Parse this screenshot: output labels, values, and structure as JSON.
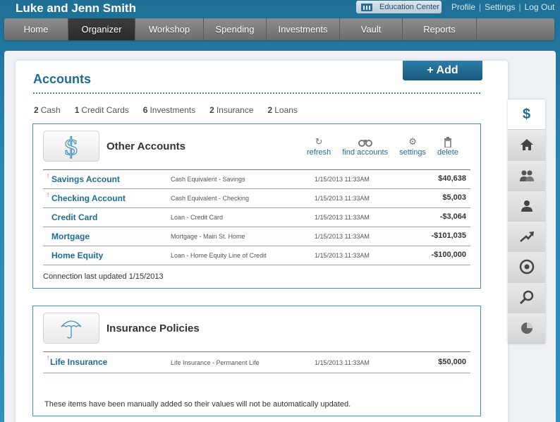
{
  "header": {
    "user_name": "Luke and Jenn Smith",
    "education_center": "Education Center",
    "links": [
      "Profile",
      "Settings",
      "Log Out"
    ]
  },
  "nav": {
    "items": [
      "Home",
      "Organizer",
      "Workshop",
      "Spending",
      "Investments",
      "Vault",
      "Reports"
    ],
    "active": "Organizer"
  },
  "page": {
    "title": "Accounts",
    "add_label": "+ Add"
  },
  "counts": [
    {
      "n": "2",
      "label": "Cash"
    },
    {
      "n": "1",
      "label": "Credit Cards"
    },
    {
      "n": "6",
      "label": "Investments"
    },
    {
      "n": "2",
      "label": "Insurance"
    },
    {
      "n": "2",
      "label": "Loans"
    }
  ],
  "other_accounts": {
    "title": "Other Accounts",
    "actions": {
      "refresh": "refresh",
      "find": "find accounts",
      "settings": "settings",
      "delete": "delete"
    },
    "rows": [
      {
        "flag": "!",
        "name": "Savings Account",
        "type": "Cash Equivalent - Savings",
        "date": "1/15/2013  11:33AM",
        "amount": "$40,638"
      },
      {
        "flag": "!",
        "name": "Checking Account",
        "type": "Cash Equivalent - Checking",
        "date": "1/15/2013  11:33AM",
        "amount": "$5,003"
      },
      {
        "flag": "",
        "name": "Credit Card",
        "type": "Loan - Credit Card",
        "date": "1/15/2013  11:33AM",
        "amount": "-$3,064"
      },
      {
        "flag": "",
        "name": "Mortgage",
        "type": "Mortgage - Main St. Home",
        "date": "1/15/2013  11:33AM",
        "amount": "-$101,035"
      },
      {
        "flag": "",
        "name": "Home Equity",
        "type": "Loan - Home Equity Line of Credit",
        "date": "1/15/2013  11:33AM",
        "amount": "-$100,000"
      }
    ],
    "footer": "Connection last updated 1/15/2013"
  },
  "insurance": {
    "title": "Insurance Policies",
    "rows": [
      {
        "flag": "!",
        "name": "Life Insurance",
        "type": "Life Insurance - Permanent  Life",
        "date": "1/15/2013  11:33AM",
        "amount": "$50,000"
      }
    ],
    "footer": "These items have been manually added so their values will not be automatically updated."
  },
  "side_tabs": {
    "dollar_symbol": "$",
    "icons": [
      "dollar-icon",
      "home-icon",
      "family-icon",
      "person-icon",
      "trend-arrow-icon",
      "target-icon",
      "magnifier-icon",
      "pie-chart-icon"
    ]
  }
}
